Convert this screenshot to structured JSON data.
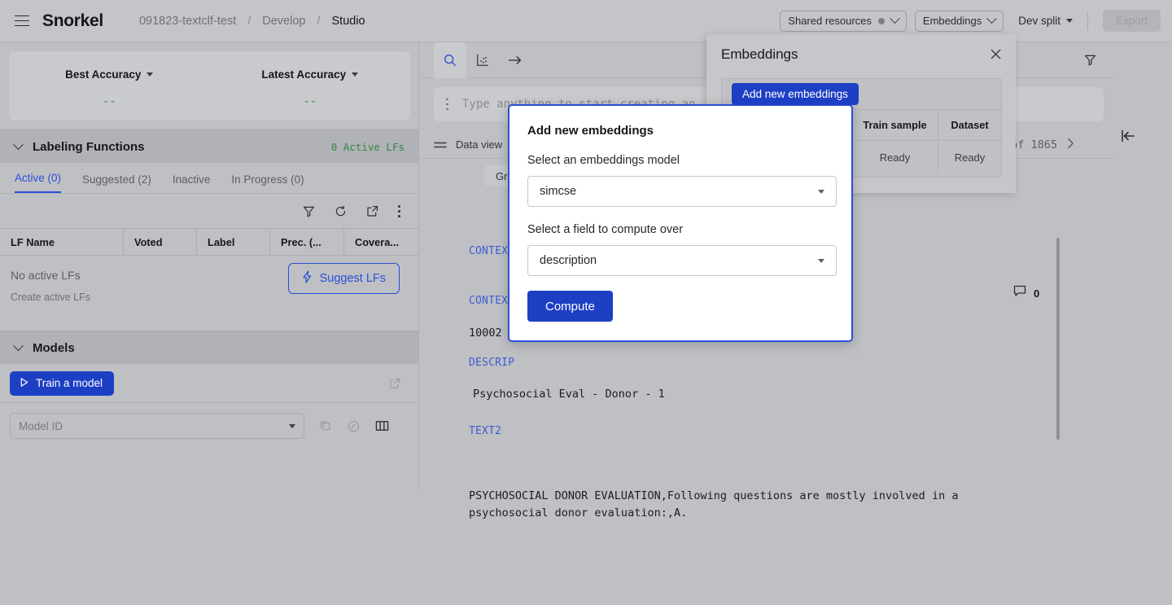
{
  "header": {
    "menu_icon": "hamburger-icon",
    "brand": "Snorkel",
    "breadcrumb": [
      "091823-textclf-test",
      "Develop",
      "Studio"
    ],
    "separator": "/",
    "shared_resources_label": "Shared resources",
    "embeddings_label": "Embeddings",
    "dev_split_label": "Dev split",
    "export_label": "Export"
  },
  "left_panel": {
    "accuracy": {
      "best_label": "Best Accuracy",
      "best_value": "--",
      "latest_label": "Latest Accuracy",
      "latest_value": "--"
    },
    "labeling_functions": {
      "title": "Labeling Functions",
      "active_count_text": "0 Active LFs",
      "tabs": [
        {
          "label": "Active (0)",
          "selected": true
        },
        {
          "label": "Suggested (2)",
          "selected": false
        },
        {
          "label": "Inactive",
          "selected": false
        },
        {
          "label": "In Progress (0)",
          "selected": false
        }
      ],
      "toolbar_icons": [
        "filter-icon",
        "refresh-icon",
        "open-external-icon",
        "more-vertical-icon"
      ],
      "columns": [
        "LF Name",
        "Voted",
        "Label",
        "Prec. (...",
        "Covera..."
      ],
      "empty_title": "No active LFs",
      "empty_subtitle": "Create active LFs",
      "suggest_button": "Suggest LFs"
    },
    "models": {
      "title": "Models",
      "train_button": "Train a model",
      "model_id_placeholder": "Model ID",
      "row_icons": [
        "copy-icon",
        "analyze-icon",
        "columns-icon"
      ],
      "open_external_icon": "open-external-icon"
    }
  },
  "main": {
    "toolbar_tabs": [
      "search-icon",
      "scatter-plot-icon",
      "arrow-right-icon"
    ],
    "filter_icon": "filter-icon",
    "search_placeholder": "Type anything to start creating an",
    "data_view_label": "Data view",
    "pagination_text": "of 1865",
    "ground_truth_chip": "Groun",
    "comment_count": "0",
    "collapse_icon": "collapse-panel-icon",
    "record_fields": [
      {
        "label": "CONTEX",
        "value": ""
      },
      {
        "label": "CONTEXT",
        "value": "10002"
      },
      {
        "label": "DESCRIP",
        "value": "Psychosocial Eval - Donor - 1"
      },
      {
        "label": "TEXT2",
        "value": "PSYCHOSOCIAL DONOR EVALUATION,Following questions are mostly involved in a psychosocial donor evaluation:,A."
      }
    ]
  },
  "embeddings_panel": {
    "title": "Embeddings",
    "close_icon": "close-icon",
    "add_button": "Add new embeddings",
    "columns": [
      "Train sample",
      "Dataset"
    ],
    "rows": [
      {
        "train_sample": "Ready",
        "dataset": "Ready"
      }
    ]
  },
  "modal": {
    "title": "Add new embeddings",
    "model_label": "Select an embeddings model",
    "model_value": "simcse",
    "field_label": "Select a field to compute over",
    "field_value": "description",
    "compute_button": "Compute"
  },
  "colors": {
    "accent_blue": "#2b4fd8",
    "button_blue": "#1d3fc4",
    "status_green": "#2f8a45",
    "field_label_blue": "#3d5ed0"
  }
}
